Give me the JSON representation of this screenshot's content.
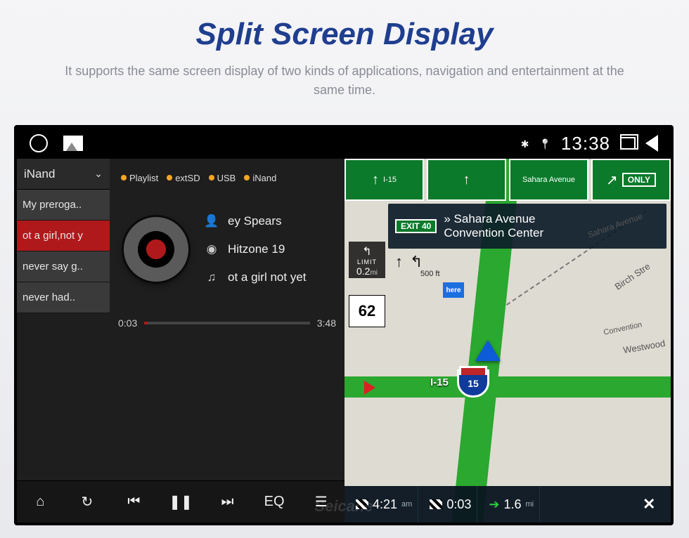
{
  "page": {
    "title": "Split Screen Display",
    "subtitle": "It supports the same screen display of two kinds of applications, navigation and entertainment at the same time."
  },
  "statusbar": {
    "time": "13:38"
  },
  "player": {
    "source_selected": "iNand",
    "sources": {
      "playlist": "Playlist",
      "extsd": "extSD",
      "usb": "USB",
      "inand": "iNand"
    },
    "tracks": [
      "My preroga..",
      "ot a girl,not y",
      "never say g..",
      "never had.."
    ],
    "active_index": 1,
    "artist": "ey Spears",
    "album": "Hitzone 19",
    "song": "ot a girl not yet",
    "elapsed": "0:03",
    "duration": "3:48",
    "eq_label": "EQ"
  },
  "nav": {
    "highway": "I-15",
    "sahara_label": "Sahara Avenue",
    "only_label": "ONLY",
    "exit_pill": "EXIT 40",
    "exit_line1": "» Sahara Avenue",
    "exit_line2": "Convention Center",
    "limit_label": "LIMIT",
    "limit_dist": "0.2",
    "limit_unit": "mi",
    "dist500": "500 ft",
    "here_label": "here",
    "speed": "62",
    "shield_num": "15",
    "shield_label": "I-15",
    "streets": {
      "birch": "Birch Stre",
      "westwood": "Westwood",
      "convention": "Convention"
    },
    "arrival_time": "4:21",
    "arrival_ampm": "am",
    "elapsed": "0:03",
    "remaining_dist": "1.6",
    "remaining_unit": "mi"
  },
  "watermark": "Seicane"
}
